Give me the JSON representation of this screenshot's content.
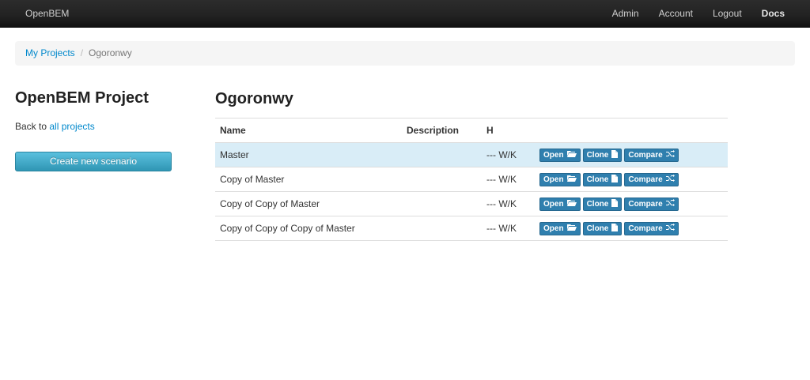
{
  "navbar": {
    "brand": "OpenBEM",
    "links": [
      "Admin",
      "Account",
      "Logout",
      "Docs"
    ]
  },
  "breadcrumb": {
    "root": "My Projects",
    "current": "Ogoronwy"
  },
  "sidebar": {
    "title": "OpenBEM Project",
    "back_prefix": "Back to ",
    "back_link": "all projects",
    "create_button": "Create new scenario"
  },
  "main": {
    "title": "Ogoronwy",
    "columns": [
      "Name",
      "Description",
      "H",
      ""
    ],
    "rows": [
      {
        "name": "Master",
        "description": "",
        "h": "--- W/K",
        "selected": true
      },
      {
        "name": "Copy of Master",
        "description": "",
        "h": "--- W/K",
        "selected": false
      },
      {
        "name": "Copy of Copy of Master",
        "description": "",
        "h": "--- W/K",
        "selected": false
      },
      {
        "name": "Copy of Copy of Copy of Master",
        "description": "",
        "h": "--- W/K",
        "selected": false
      }
    ],
    "row_buttons": {
      "open": "Open",
      "clone": "Clone",
      "compare": "Compare"
    },
    "icons": {
      "open": "folder-open-icon",
      "clone": "file-icon",
      "compare": "shuffle-icon"
    }
  },
  "colors": {
    "link": "#0088cc",
    "selected_row": "#d9edf7",
    "action_button": "#2f7fae",
    "info_button": "#49afcd"
  }
}
